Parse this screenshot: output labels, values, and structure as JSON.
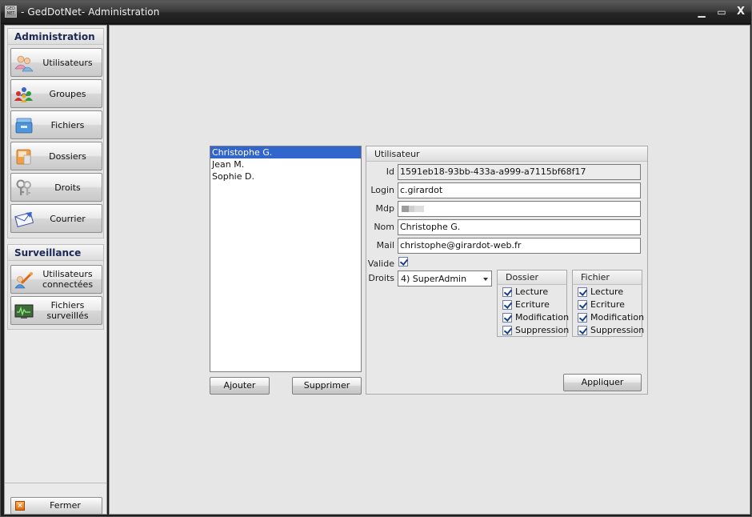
{
  "window": {
    "title": "- GedDotNet- Administration",
    "icon_text": "GED NET",
    "controls": {
      "minimize": "▁",
      "maximize": "▭",
      "close": "X"
    }
  },
  "sidebar": {
    "administration": {
      "header": "Administration",
      "items": [
        {
          "label": "Utilisateurs",
          "icon": "users-icon"
        },
        {
          "label": "Groupes",
          "icon": "groups-icon"
        },
        {
          "label": "Fichiers",
          "icon": "files-icon"
        },
        {
          "label": "Dossiers",
          "icon": "folders-icon"
        },
        {
          "label": "Droits",
          "icon": "keys-icon"
        },
        {
          "label": "Courrier",
          "icon": "mail-icon"
        }
      ]
    },
    "surveillance": {
      "header": "Surveillance",
      "items": [
        {
          "label": "Utilisateurs connectées",
          "icon": "connected-users-icon"
        },
        {
          "label": "Fichiers surveillés",
          "icon": "monitor-icon"
        }
      ]
    },
    "close_label": "Fermer",
    "close_icon_glyph": "×"
  },
  "users": {
    "items": [
      "Christophe G.",
      "Jean M.",
      "Sophie D."
    ],
    "selected_index": 0,
    "add_label": "Ajouter",
    "delete_label": "Supprimer"
  },
  "user_panel": {
    "header": "Utilisateur",
    "id_label": "Id",
    "id_value": "1591eb18-93bb-433a-a999-a7115bf68f17",
    "login_label": "Login",
    "login_value": "c.girardot",
    "password_label": "Mdp",
    "name_label": "Nom",
    "name_value": "Christophe G.",
    "mail_label": "Mail",
    "mail_value": "christophe@girardot-web.fr",
    "valid_label": "Valide",
    "valid_checked": true,
    "rights_label": "Droits",
    "rights_value": "4) SuperAdmin",
    "folder_permissions": {
      "header": "Dossier",
      "items": [
        "Lecture",
        "Ecriture",
        "Modification",
        "Suppression"
      ]
    },
    "file_permissions": {
      "header": "Fichier",
      "items": [
        "Lecture",
        "Ecriture",
        "Modification",
        "Suppression"
      ]
    },
    "apply_label": "Appliquer"
  }
}
